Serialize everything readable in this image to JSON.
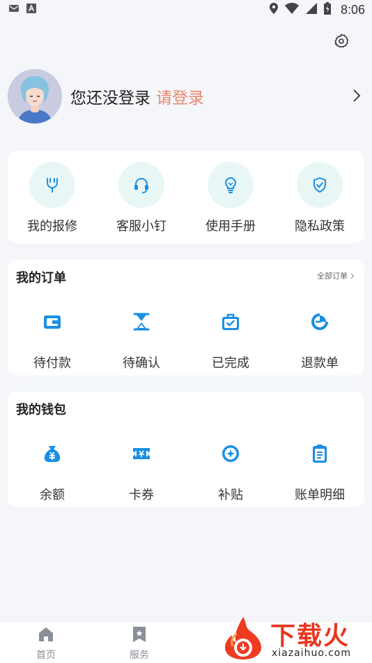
{
  "status_bar": {
    "time": "8:06",
    "left_icons": [
      "mail-icon",
      "font-a-icon"
    ],
    "right_icons": [
      "location-icon",
      "wifi-icon",
      "signal-icon",
      "battery-icon"
    ]
  },
  "header": {
    "settings_icon": "gear-icon"
  },
  "profile": {
    "login_text": "您还没登录",
    "login_link": "请登录",
    "accent_color": "#e8886a"
  },
  "quick_actions": [
    {
      "label": "我的报修",
      "icon": "wrench-icon"
    },
    {
      "label": "客服小钉",
      "icon": "headset-icon"
    },
    {
      "label": "使用手册",
      "icon": "lightbulb-icon"
    },
    {
      "label": "隐私政策",
      "icon": "shield-check-icon"
    }
  ],
  "orders": {
    "title": "我的订单",
    "more": "全部订单",
    "items": [
      {
        "label": "待付款",
        "icon": "wallet-icon"
      },
      {
        "label": "待确认",
        "icon": "hourglass-icon"
      },
      {
        "label": "已完成",
        "icon": "briefcase-check-icon"
      },
      {
        "label": "退款单",
        "icon": "refund-icon"
      }
    ]
  },
  "wallet": {
    "title": "我的钱包",
    "items": [
      {
        "label": "余额",
        "icon": "money-bag-icon"
      },
      {
        "label": "卡券",
        "icon": "ticket-icon"
      },
      {
        "label": "补贴",
        "icon": "subsidy-icon"
      },
      {
        "label": "账单明细",
        "icon": "clipboard-icon"
      }
    ]
  },
  "tabbar": {
    "items": [
      {
        "label": "首页",
        "icon": "home-icon"
      },
      {
        "label": "服务",
        "icon": "bookmark-icon"
      }
    ]
  },
  "watermark": {
    "title": "下载火",
    "url": "xiazaihuo.com"
  },
  "colors": {
    "icon_blue": "#1a8fe3",
    "tint_bg": "#e8f6f6",
    "page_bg": "#f4f6fa"
  }
}
